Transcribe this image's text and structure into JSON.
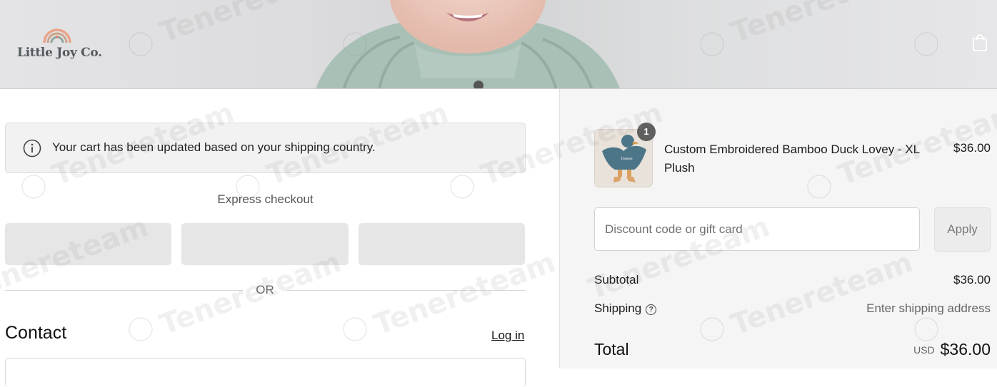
{
  "header": {
    "logo_text": "Little Joy Co.",
    "bag_icon": "shopping-bag-icon"
  },
  "notice": {
    "icon": "info-icon",
    "text": "Your cart has been updated based on your shipping country."
  },
  "express": {
    "label": "Express checkout",
    "or_label": "OR"
  },
  "contact": {
    "heading": "Contact",
    "login_label": "Log in"
  },
  "order": {
    "item": {
      "name": "Custom Embroidered Bamboo Duck Lovey - XL Plush",
      "price": "$36.00",
      "quantity": "1",
      "thumb_label": "Tenlee"
    },
    "discount": {
      "placeholder": "Discount code or gift card",
      "apply_label": "Apply"
    },
    "subtotal_label": "Subtotal",
    "subtotal_value": "$36.00",
    "shipping_label": "Shipping",
    "shipping_help_icon": "question-circle-icon",
    "shipping_value": "Enter shipping address",
    "total_label": "Total",
    "currency": "USD",
    "total_value": "$36.00"
  },
  "watermark": {
    "text": "Tenereteam",
    "seal_text": "tenere"
  },
  "colors": {
    "right_panel_bg": "#f5f5f5",
    "notice_bg": "#f2f2f2",
    "express_button_bg": "#e6e6e6",
    "quantity_badge": "#5f5f5f"
  }
}
